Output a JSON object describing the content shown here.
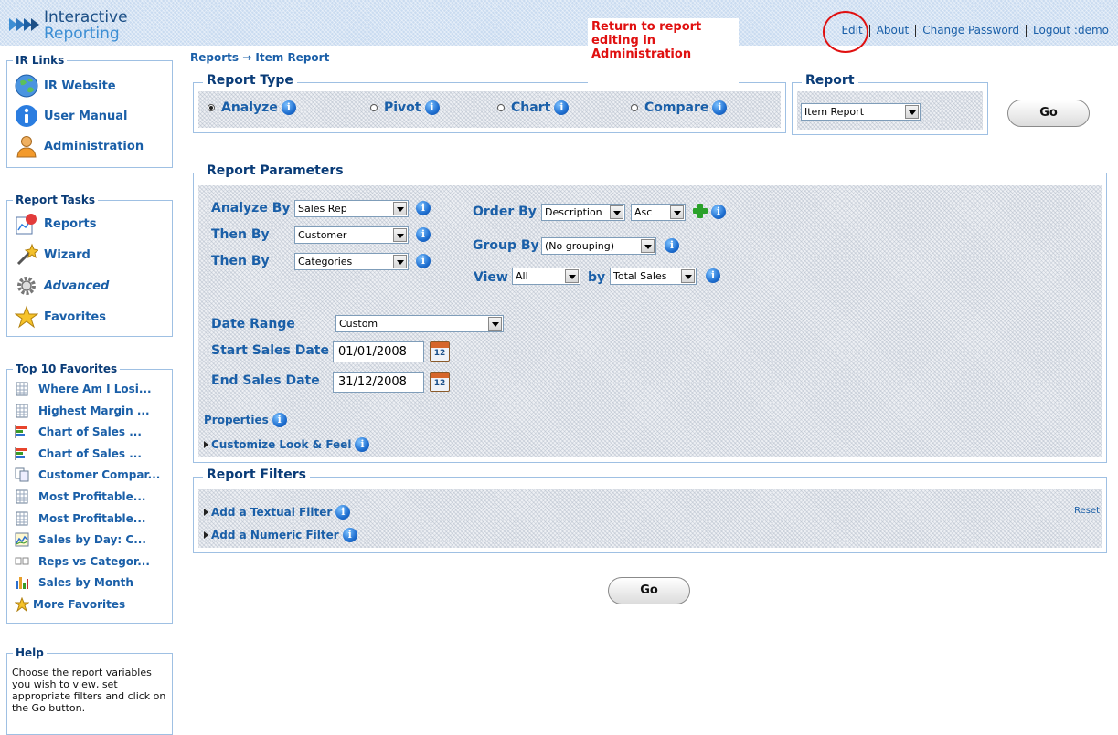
{
  "header": {
    "logo_line1": "Interactive",
    "logo_line2": "Reporting",
    "links": [
      "Edit",
      "About",
      "Change Password",
      "Logout :demo"
    ]
  },
  "callout": {
    "text_line1": "Return to report",
    "text_line2": "editing in",
    "text_line3": "Administration",
    "color": "#e01010"
  },
  "sidebar": {
    "ir_links": {
      "title": "IR Links",
      "items": [
        {
          "label": "IR Website",
          "icon": "globe-icon"
        },
        {
          "label": "User Manual",
          "icon": "info-icon"
        },
        {
          "label": "Administration",
          "icon": "user-icon"
        }
      ]
    },
    "report_tasks": {
      "title": "Report Tasks",
      "items": [
        {
          "label": "Reports",
          "icon": "reports-icon"
        },
        {
          "label": "Wizard",
          "icon": "wand-icon"
        },
        {
          "label": "Advanced",
          "icon": "gear-icon"
        },
        {
          "label": "Favorites",
          "icon": "star-icon"
        }
      ]
    },
    "top10": {
      "title": "Top 10 Favorites",
      "items": [
        {
          "label": "Where Am I Losi...",
          "icon": "grid-icon"
        },
        {
          "label": "Highest Margin ...",
          "icon": "grid-icon"
        },
        {
          "label": "Chart of Sales ...",
          "icon": "bar-chart-icon"
        },
        {
          "label": "Chart of Sales ...",
          "icon": "bar-chart-icon"
        },
        {
          "label": "Customer Compar...",
          "icon": "compare-icon"
        },
        {
          "label": "Most Profitable...",
          "icon": "grid-icon"
        },
        {
          "label": "Most Profitable...",
          "icon": "grid-icon"
        },
        {
          "label": "Sales by Day: C...",
          "icon": "line-chart-icon"
        },
        {
          "label": "Reps vs Categor...",
          "icon": "pivot-icon"
        },
        {
          "label": "Sales by Month",
          "icon": "column-chart-icon"
        },
        {
          "label": "More Favorites",
          "icon": "star-icon"
        }
      ]
    },
    "help": {
      "title": "Help",
      "text": "Choose the report variables you wish to view, set appropriate filters and click on the Go button."
    }
  },
  "breadcrumb": "Reports → Item Report",
  "report_type": {
    "title": "Report Type",
    "options": [
      "Analyze",
      "Pivot",
      "Chart",
      "Compare"
    ],
    "selected": "Analyze"
  },
  "report": {
    "title": "Report",
    "selected": "Item Report",
    "go_label": "Go"
  },
  "params": {
    "title": "Report Parameters",
    "analyze_by_label": "Analyze By",
    "analyze_by_value": "Sales Rep",
    "then_by1_label": "Then By",
    "then_by1_value": "Customer",
    "then_by2_label": "Then By",
    "then_by2_value": "Categories",
    "order_by_label": "Order By",
    "order_by_value": "Description",
    "order_dir_value": "Asc",
    "group_by_label": "Group By",
    "group_by_value": "(No grouping)",
    "view_label": "View",
    "view_value": "All",
    "by_label": "by",
    "by_value": "Total Sales",
    "date_range_label": "Date Range",
    "date_range_value": "Custom",
    "start_label": "Start Sales Date",
    "start_value": "01/01/2008",
    "end_label": "End Sales Date",
    "end_value": "31/12/2008",
    "calendar_day": "12",
    "properties_label": "Properties",
    "customize_label": "Customize Look & Feel"
  },
  "filters": {
    "title": "Report Filters",
    "textual_label": "Add a Textual Filter",
    "numeric_label": "Add a Numeric Filter",
    "reset_label": "Reset"
  },
  "go_bottom_label": "Go"
}
